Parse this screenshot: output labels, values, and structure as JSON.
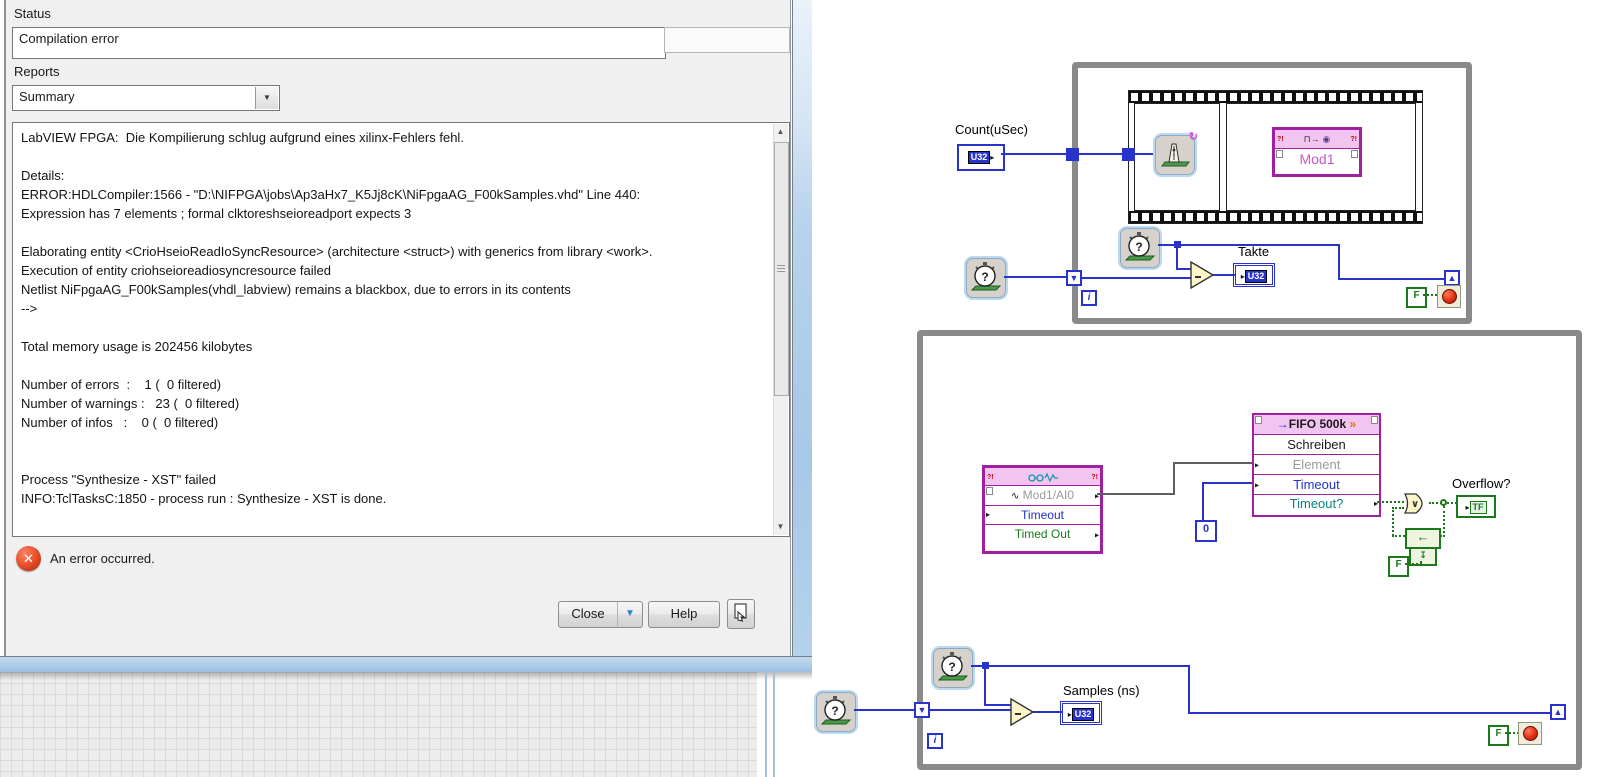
{
  "dialog": {
    "status_label": "Status",
    "status_value": "Compilation error",
    "reports_label": "Reports",
    "reports_value": "Summary",
    "report_text": "LabVIEW FPGA:  Die Kompilierung schlug aufgrund eines xilinx-Fehlers fehl.\n\nDetails:\nERROR:HDLCompiler:1566 - \"D:\\NIFPGA\\jobs\\Ap3aHx7_K5Jj8cK\\NiFpgaAG_F00kSamples.vhd\" Line 440:\nExpression has 7 elements ; formal clktoreshseioreadport expects 3\n\nElaborating entity <CrioHseioReadIoSyncResource> (architecture <struct>) with generics from library <work>.\nExecution of entity criohseioreadiosyncresource failed\nNetlist NiFpgaAG_F00kSamples(vhdl_labview) remains a blackbox, due to errors in its contents\n-->\n\nTotal memory usage is 202456 kilobytes\n\nNumber of errors  :    1 (  0 filtered)\nNumber of warnings :   23 (  0 filtered)\nNumber of infos   :    0 (  0 filtered)\n\n\nProcess \"Synthesize - XST\" failed\nINFO:TclTasksC:1850 - process run : Synthesize - XST is done.",
    "error_message": "An error occurred.",
    "close_label": "Close",
    "help_label": "Help"
  },
  "diagram": {
    "top_loop": {
      "count_label": "Count(uSec)",
      "count_type": "U32",
      "mod1_label": "Mod1",
      "takte_label": "Takte",
      "takte_type": "U32",
      "false_const": "F",
      "iteration": "i"
    },
    "bottom_loop": {
      "ai_node": {
        "title": "Mod1/AI0",
        "timeout": "Timeout",
        "timed_out": "Timed Out"
      },
      "fifo_node": {
        "title": "FIFO 500k",
        "method": "Schreiben",
        "element": "Element",
        "timeout": "Timeout",
        "timeout_q": "Timeout?"
      },
      "zero_const": "0",
      "overflow_label": "Overflow?",
      "overflow_type": "TF",
      "samples_label": "Samples (ns)",
      "samples_type": "U32",
      "false_const": "F",
      "iteration": "i"
    },
    "colors": {
      "wire_blue": "#2833cc",
      "loop_gray": "#8a8a8a",
      "node_magenta": "#a020a0",
      "node_pink": "#f2c4f2",
      "bool_green": "#1a7a1a",
      "error_red": "#e03010",
      "aero_blue": "#a8c8e7"
    }
  },
  "icons": {
    "combo_arrow": "▼",
    "scroll_up": "▲",
    "scroll_down": "▼",
    "close_menu_arrow": "▼",
    "tunnel_down": "▼",
    "tunnel_up": "▲",
    "in_arrow": "▸",
    "or_symbol": "∨",
    "minus": "−",
    "question": "?",
    "refresh": "↻",
    "pulse": "⊓→",
    "adc_dot": "◉",
    "fifo_in": "→",
    "fifo_out": "»",
    "warn": "?!",
    "wave": "∿",
    "feedback_arrow": "←",
    "feedback_init": "↧",
    "error_x": "✕"
  }
}
